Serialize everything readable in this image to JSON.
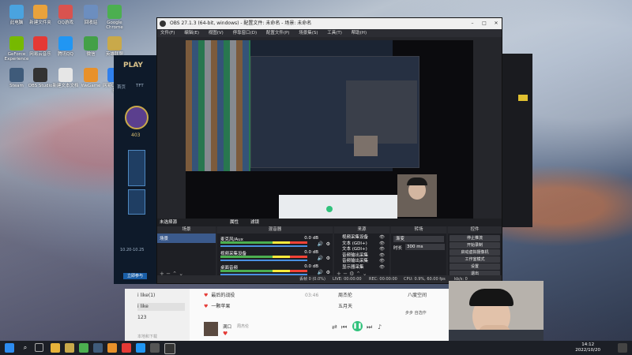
{
  "desktop": {
    "icons": [
      {
        "label": "此电脑",
        "color": "#4aa3df"
      },
      {
        "label": "新建文件夹",
        "color": "#e9a23b"
      },
      {
        "label": "QQ游戏",
        "color": "#d9534f"
      },
      {
        "label": "回收站",
        "color": "#6c8ebf"
      },
      {
        "label": "Google Chrome",
        "color": "#4caf50"
      },
      {
        "label": "GeForce Experience",
        "color": "#76b900"
      },
      {
        "label": "网易云音乐",
        "color": "#e53935"
      },
      {
        "label": "腾讯QQ",
        "color": "#2196f3"
      },
      {
        "label": "微信",
        "color": "#43a047"
      },
      {
        "label": "英雄联盟",
        "color": "#c9a94a"
      },
      {
        "label": "Steam",
        "color": "#3f5b7a"
      },
      {
        "label": "OBS Studio",
        "color": "#333333"
      },
      {
        "label": "新建文本文档",
        "color": "#e6e6e6"
      },
      {
        "label": "WeGame",
        "color": "#e8912a"
      },
      {
        "label": "网易UU加速器",
        "color": "#2f80ed"
      }
    ],
    "wallpaper_theme": "fantasy-league-art"
  },
  "obs": {
    "title": "OBS 27.1.3 (64-bit, windows) - 配置文件: 未命名 - 场景: 未命名",
    "menu": [
      "文件(F)",
      "编辑(E)",
      "视图(V)",
      "停靠窗口(D)",
      "配置文件(P)",
      "场景集(S)",
      "工具(T)",
      "帮助(H)"
    ],
    "scene_bar": {
      "label": "未选择源",
      "properties": "属性",
      "filters": "滤镜"
    },
    "panels": {
      "scenes": {
        "title": "场景",
        "items": [
          "场景"
        ]
      },
      "mixer": {
        "title": "混音器",
        "channels": [
          {
            "name": "麦克风/Aux",
            "db": "0.0 dB"
          },
          {
            "name": "视频采集设备",
            "db": "0.0 dB"
          },
          {
            "name": "桌面音频",
            "db": "0.0 dB"
          }
        ]
      },
      "sources": {
        "title": "来源",
        "items": [
          "视频采集设备",
          "文本 (GDI+)",
          "文本 (GDI+)",
          "音频输出采集",
          "音频输出采集",
          "显示器采集"
        ]
      },
      "transitions": {
        "title": "转场",
        "mode": "渐变",
        "duration_label": "时长",
        "duration": "300 ms"
      },
      "controls": {
        "title": "控件",
        "buttons": [
          "停止推流",
          "开始录制",
          "启动虚拟摄像机",
          "工作室模式",
          "设置",
          "退出"
        ]
      }
    },
    "status": {
      "live": "LIVE: 00:00:00",
      "rec": "REC: 00:00:00",
      "cpu": "CPU: 0.9%, 60.00 fps",
      "dropped": "丢帧 0 (0.0%)",
      "kbps": "kb/s: 0"
    }
  },
  "lol_client": {
    "title": "PLAY",
    "nav": [
      "首页",
      "TFT"
    ],
    "currency": "403",
    "promo": "10.20-10.25",
    "button": "立即参与"
  },
  "music_player": {
    "playlist": [
      {
        "label": "i like(1)"
      },
      {
        "label": "i like"
      },
      {
        "label": "123"
      }
    ],
    "library_label": "本地和下载",
    "tracks": [
      {
        "title": "最后的战役",
        "artist": "周杰伦",
        "album": "八度空间",
        "duration": "03:46"
      },
      {
        "title": "一颗苹果",
        "artist": "五月天",
        "album": "",
        "duration": ""
      }
    ],
    "now_playing": {
      "title": "满口",
      "artist": "周杰伦",
      "album": "步步 自选作"
    }
  },
  "taskbar": {
    "time": "14:12",
    "date": "2022/10/20"
  },
  "colors": {
    "obs_bg": "#25262b",
    "accent": "#4a90e2",
    "meter_green": "#4caf50",
    "meter_red": "#f44336",
    "play_green": "#31c27c"
  }
}
